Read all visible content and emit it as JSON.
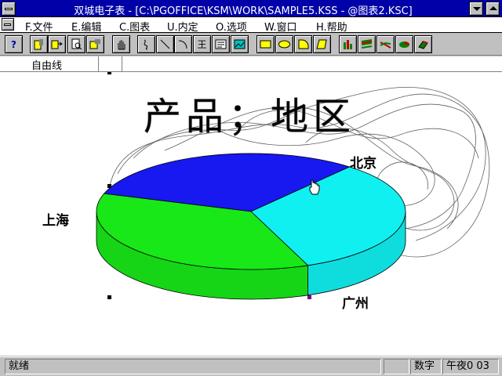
{
  "window": {
    "title": "双城电子表 - [C:\\PGOFFICE\\KSM\\WORK\\SAMPLE5.KSS - @图表2.KSC]"
  },
  "menu": {
    "items": [
      {
        "label": "F.文件"
      },
      {
        "label": "E.编辑"
      },
      {
        "label": "C.图表"
      },
      {
        "label": "U.内定"
      },
      {
        "label": "O.选项"
      },
      {
        "label": "W.窗口"
      },
      {
        "label": "H.帮助"
      }
    ]
  },
  "toolbar": {
    "help_glyph": "?",
    "text_glyph": "王"
  },
  "object_bar": {
    "label": "自由线"
  },
  "chart_data": {
    "type": "pie",
    "title": "产品；地区",
    "categories": [
      "上海",
      "北京",
      "广州"
    ],
    "values": [
      36,
      31,
      33
    ],
    "colors": {
      "上海": "#18e818",
      "北京": "#1818f0",
      "广州": "#10f0f0"
    }
  },
  "status": {
    "left": "就绪",
    "mode": "数字",
    "time": "午夜0 03"
  }
}
